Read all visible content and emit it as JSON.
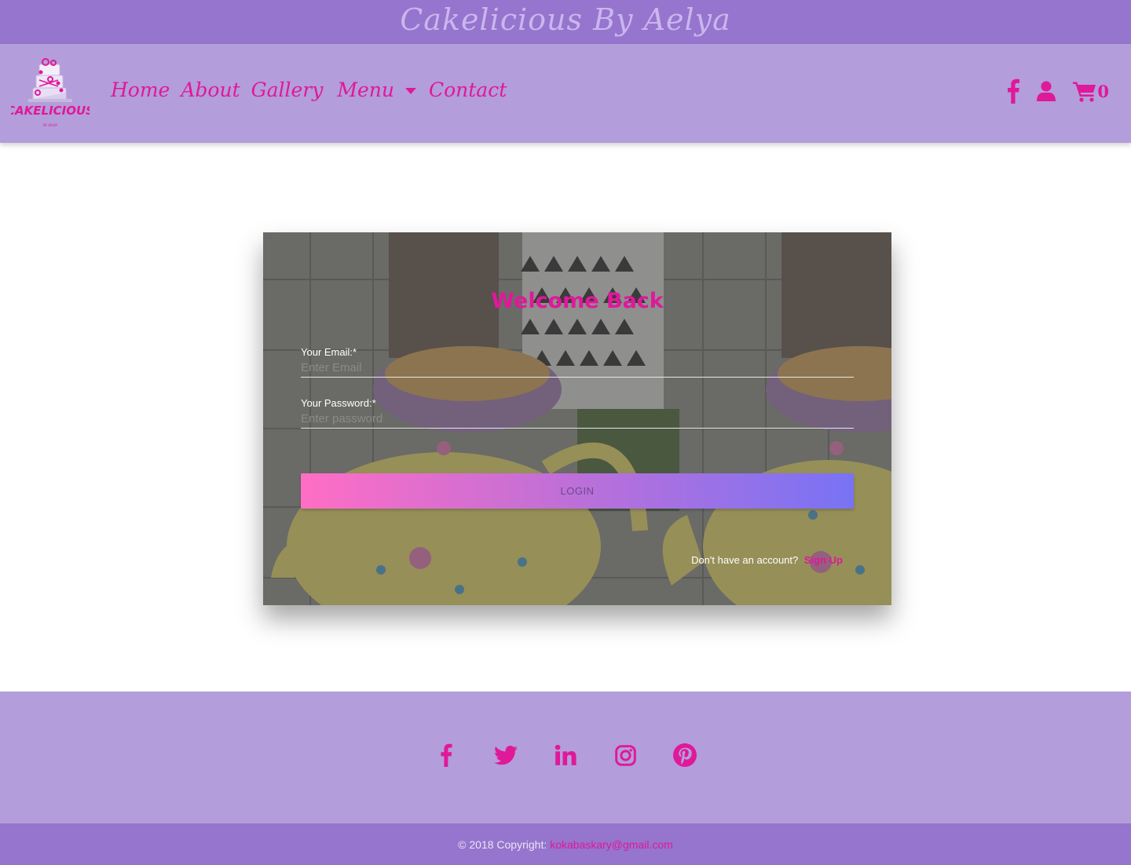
{
  "banner": {
    "title": "Cakelicious By Aelya"
  },
  "logo": {
    "text": "CAKELICIOUS",
    "subtext": "BY AELYA"
  },
  "nav": {
    "links": [
      "Home",
      "About",
      "Gallery",
      "Menu",
      "Contact"
    ],
    "cart_count": "0",
    "icons": [
      "facebook-icon",
      "user-icon",
      "cart-icon"
    ]
  },
  "login": {
    "title": "Welcome Back",
    "email_label": "Your Email:*",
    "email_placeholder": "Enter Email",
    "email_value": "",
    "password_label": "Your Password:*",
    "password_placeholder": "Enter password",
    "password_value": "",
    "button_label": "LOGIN",
    "signup_prompt": "Don't have an account?",
    "signup_link": "Sign Up"
  },
  "footer": {
    "social_icons": [
      "facebook-icon",
      "twitter-icon",
      "linkedin-icon",
      "instagram-icon",
      "pinterest-icon"
    ],
    "copyright": "© 2018 Copyright:",
    "email": "kokabaskary@gmail.com"
  },
  "colors": {
    "accent": "#e0189a",
    "banner_bg": "#9575cd",
    "nav_bg": "#b39ddb",
    "gradient_start": "#ff6ec4",
    "gradient_end": "#7873f5"
  }
}
